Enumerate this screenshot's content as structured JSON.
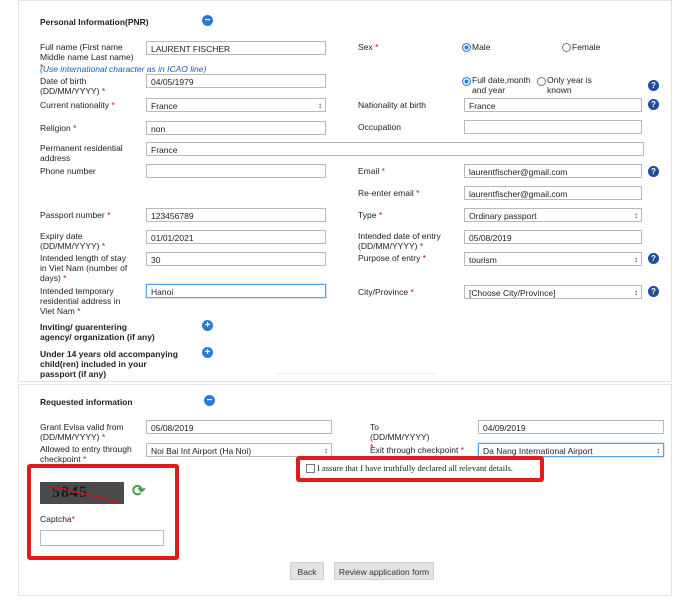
{
  "personal": {
    "section_title": "Personal Information(PNR)",
    "fullname_label": "Full name (First name Middle name Last name)",
    "fullname_hint": "(Use international character as in ICAO line)",
    "fullname_value": "LAURENT FISCHER",
    "sex_label": "Sex",
    "sex_male": "Male",
    "sex_female": "Female",
    "dob_label": "Date of birth (DD/MM/YYYY)",
    "dob_value": "04/05/1979",
    "dob_full": "Full date,month and year",
    "dob_year": "Only year is known",
    "nationality_label": "Current nationality",
    "nationality_value": "France",
    "birth_nationality_label": "Nationality at birth",
    "birth_nationality_value": "France",
    "religion_label": "Religion",
    "religion_value": "non",
    "occupation_label": "Occupation",
    "occupation_value": "",
    "residence_label": "Permanent residential address",
    "residence_value": "France",
    "phone_label": "Phone number",
    "phone_value": "",
    "email_label": "Email",
    "email_value": "laurentfischer@gmail.com",
    "reemail_label": "Re-enter email",
    "reemail_value": "laurentfischer@gmail.com",
    "passport_label": "Passport number",
    "passport_value": "123456789",
    "type_label": "Type",
    "type_value": "Ordinary passport",
    "expiry_label": "Expiry date (DD/MM/YYYY)",
    "expiry_value": "01/01/2021",
    "entry_date_label": "Intended date of entry (DD/MM/YYYY)",
    "entry_date_value": "05/08/2019",
    "stay_label": "Intended length of stay in Viet Nam (number of days)",
    "stay_value": "30",
    "purpose_label": "Purpose of entry",
    "purpose_value": "tourism",
    "temp_addr_label": "Intended temporary residential address in Viet Nam",
    "temp_addr_value": "Hanoi",
    "city_label": "City/Province",
    "city_value": "[Choose City/Province]",
    "agency_label": "Inviting/ guarentering agency/ organization (if any)",
    "children_label": "Under 14 years old accompanying child(ren) included in your passport (if any)"
  },
  "requested": {
    "section_title": "Requested information",
    "valid_from_label": "Grant Evisa valid from (DD/MM/YYYY)",
    "valid_from_value": "05/08/2019",
    "to_label": "To (DD/MM/YYYY)",
    "to_value": "04/09/2019",
    "entry_checkpoint_label": "Allowed to entry through checkpoint",
    "entry_checkpoint_value": "Noi Bai Int Airport (Ha Noi)",
    "exit_checkpoint_label": "Exit through checkpoint",
    "exit_checkpoint_value": "Da Nang International Airport",
    "assure_text": "I assure that I have truthfully declared all relevant details.",
    "captcha_image_text": "5845",
    "captcha_label": "Captcha",
    "captcha_value": ""
  },
  "buttons": {
    "back": "Back",
    "review": "Review application form"
  },
  "symbols": {
    "required": "*",
    "minus": "−",
    "plus": "+",
    "help": "?",
    "refresh": "⟳"
  },
  "colors": {
    "accent": "#2a7bd6",
    "highlight": "#e01b1b",
    "required": "#d01010"
  }
}
